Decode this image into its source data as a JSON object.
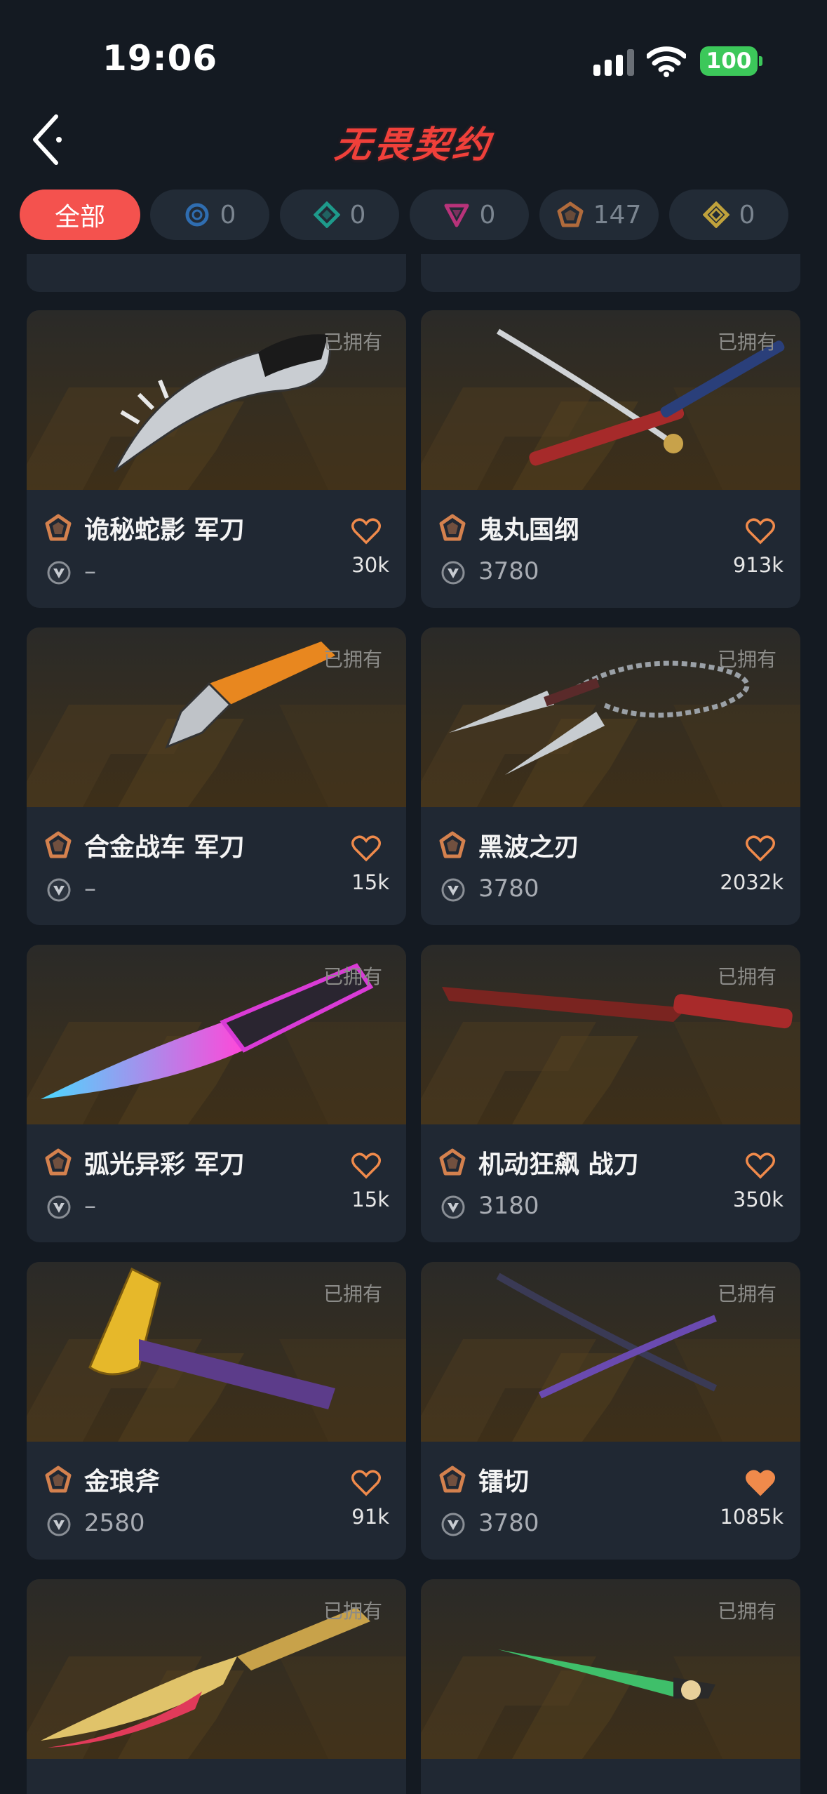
{
  "status_bar": {
    "time": "19:06",
    "battery": "100"
  },
  "header": {
    "title": "无畏契约",
    "back_icon": "back-chevron-icon"
  },
  "filters": [
    {
      "label": "全部",
      "active": true,
      "icon": null,
      "color": "#f4524e"
    },
    {
      "label": "0",
      "icon": "rarity-select-icon",
      "color": "#2f6db0"
    },
    {
      "label": "0",
      "icon": "rarity-deluxe-icon",
      "color": "#1e9a8b"
    },
    {
      "label": "0",
      "icon": "rarity-premium-icon",
      "color": "#b8337a"
    },
    {
      "label": "147",
      "icon": "rarity-exclusive-icon",
      "color": "#b06b3c"
    },
    {
      "label": "0",
      "icon": "rarity-ultra-icon",
      "color": "#c0a23c"
    }
  ],
  "owned_label": "已拥有",
  "skins": [
    {
      "name": "诡秘蛇影 军刀",
      "price": "–",
      "likes": "30k",
      "liked": false,
      "weapon_icon": "karambit-knife-icon"
    },
    {
      "name": "鬼丸国纲",
      "price": "3780",
      "likes": "913k",
      "liked": false,
      "weapon_icon": "katana-sword-icon"
    },
    {
      "name": "合金战车 军刀",
      "price": "–",
      "likes": "15k",
      "liked": false,
      "weapon_icon": "utility-knife-icon"
    },
    {
      "name": "黑波之刃",
      "price": "3780",
      "likes": "2032k",
      "liked": false,
      "weapon_icon": "chain-kunai-icon"
    },
    {
      "name": "弧光异彩 军刀",
      "price": "–",
      "likes": "15k",
      "liked": false,
      "weapon_icon": "neon-knife-icon"
    },
    {
      "name": "机动狂飙 战刀",
      "price": "3180",
      "likes": "350k",
      "liked": false,
      "weapon_icon": "mech-blade-icon"
    },
    {
      "name": "金琅斧",
      "price": "2580",
      "likes": "91k",
      "liked": false,
      "weapon_icon": "golden-axe-icon"
    },
    {
      "name": "镭切",
      "price": "3780",
      "likes": "1085k",
      "liked": true,
      "weapon_icon": "twin-katana-icon"
    },
    {
      "name": "",
      "price": "",
      "likes": "",
      "liked": false,
      "weapon_icon": "golden-scimitar-icon"
    },
    {
      "name": "",
      "price": "",
      "likes": "",
      "liked": false,
      "weapon_icon": "emerald-dagger-icon"
    }
  ],
  "colors": {
    "accent": "#f4524e",
    "exclusive_tier": "#d4814e",
    "heart": "#f08a4b",
    "background": "#141a22",
    "card": "#202833"
  }
}
